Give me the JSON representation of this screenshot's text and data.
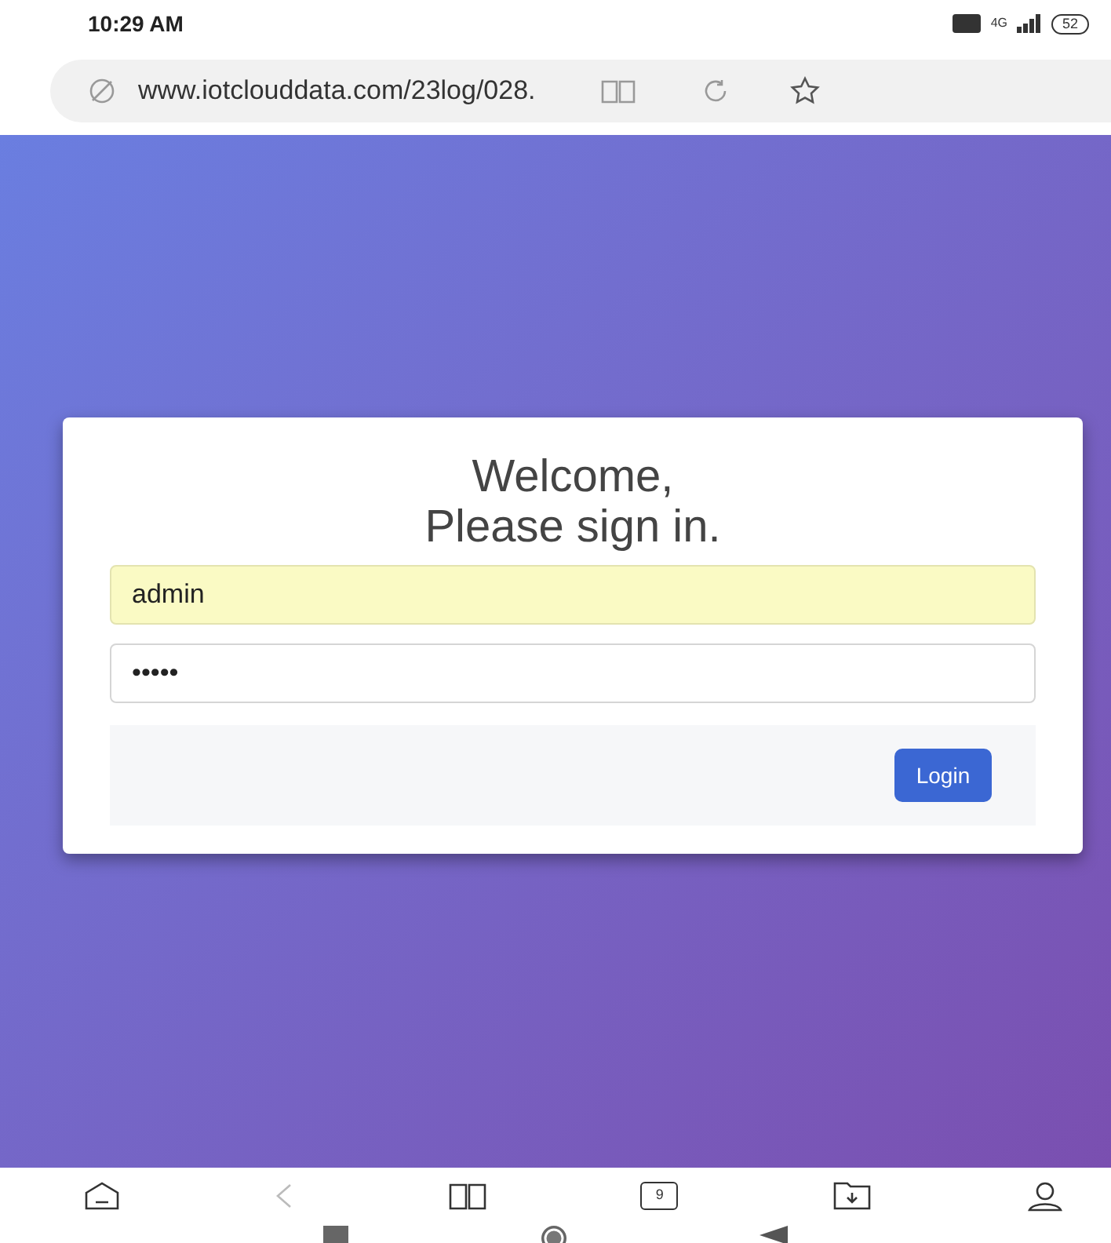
{
  "status_bar": {
    "time": "10:29 AM",
    "network": "4G",
    "battery": "52"
  },
  "address_bar": {
    "url": "www.iotclouddata.com/23log/028."
  },
  "login_card": {
    "title_line1": "Welcome,",
    "title_line2": "Please sign in.",
    "username": {
      "value": "admin",
      "autofilled": true
    },
    "password": {
      "value": "•••••",
      "autofilled": false
    },
    "button": "Login"
  },
  "bottom_nav": {
    "back_disabled": true,
    "tab_count": "9"
  }
}
